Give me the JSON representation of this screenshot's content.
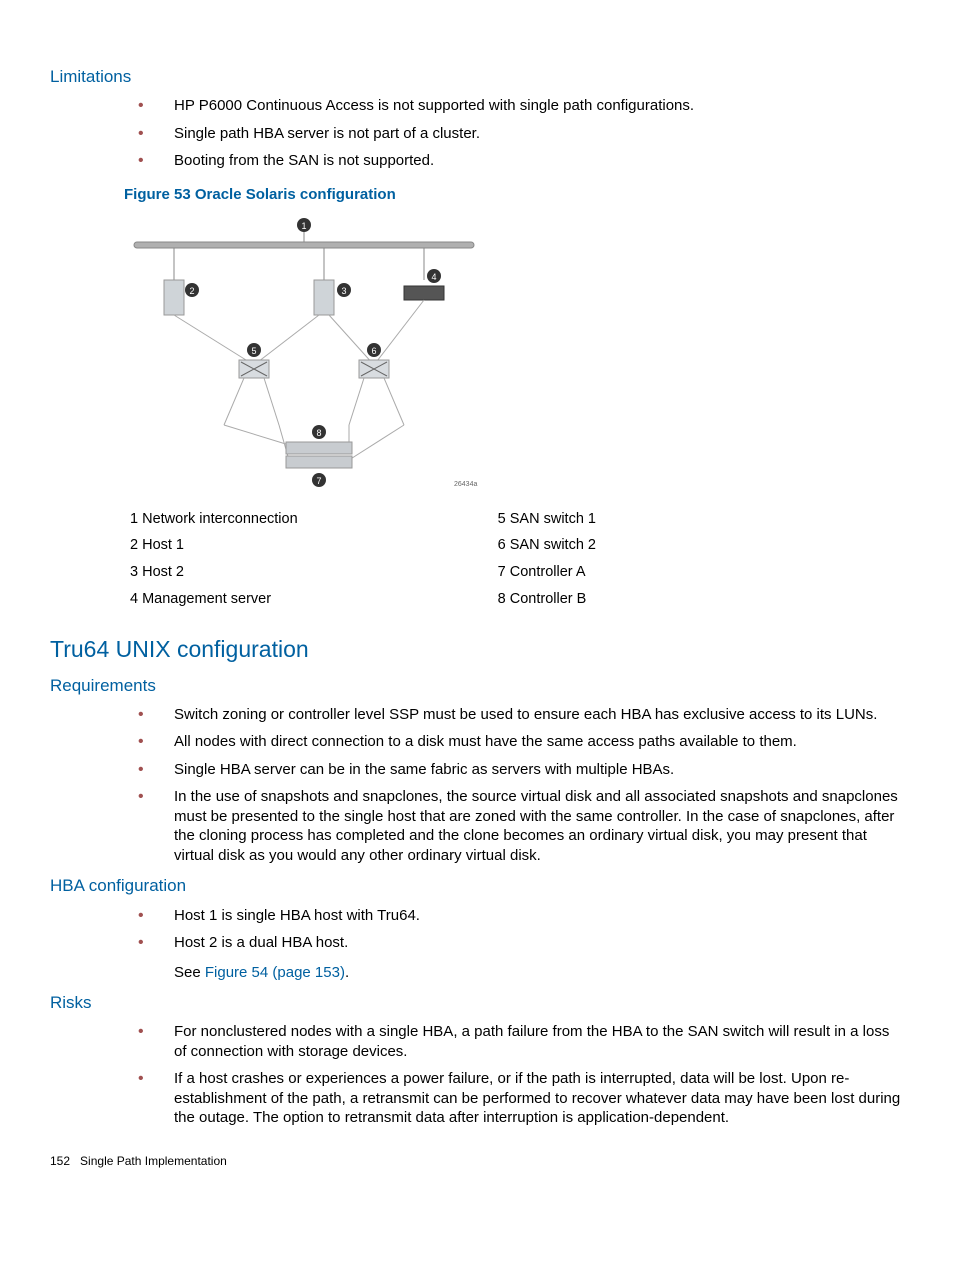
{
  "limitations": {
    "heading": "Limitations",
    "items": [
      "HP P6000 Continuous Access is not supported with single path configurations.",
      "Single path HBA server is not part of a cluster.",
      "Booting from the SAN is not supported."
    ]
  },
  "figure": {
    "caption": "Figure 53 Oracle Solaris configuration",
    "ref": "26434a",
    "legend_left": [
      "1 Network interconnection",
      "2 Host 1",
      "3 Host 2",
      "4 Management server"
    ],
    "legend_right": [
      "5 SAN switch 1",
      "6 SAN switch 2",
      "7 Controller A",
      "8 Controller B"
    ]
  },
  "section": {
    "heading": "Tru64 UNIX configuration"
  },
  "requirements": {
    "heading": "Requirements",
    "items": [
      "Switch zoning or controller level SSP must be used to ensure each HBA has exclusive access to its LUNs.",
      "All nodes with direct connection to a disk must have the same access paths available to them.",
      "Single HBA server can be in the same fabric as servers with multiple HBAs.",
      "In the use of snapshots and snapclones, the source virtual disk and all associated snapshots and snapclones must be presented to the single host that are zoned with the same controller. In the case of snapclones, after the cloning process has completed and the clone becomes an ordinary virtual disk, you may present that virtual disk as you would any other ordinary virtual disk."
    ]
  },
  "hba": {
    "heading": "HBA configuration",
    "items": [
      "Host 1 is single HBA host with Tru64.",
      "Host 2 is a dual HBA host."
    ],
    "see_prefix": "See ",
    "see_link": "Figure 54 (page 153)",
    "see_suffix": "."
  },
  "risks": {
    "heading": "Risks",
    "items": [
      "For nonclustered nodes with a single HBA, a path failure from the HBA to the SAN switch will result in a loss of connection with storage devices.",
      "If a host crashes or experiences a power failure, or if the path is interrupted, data will be lost. Upon re-establishment of the path, a retransmit can be performed to recover whatever data may have been lost during the outage. The option to retransmit data after interruption is application-dependent."
    ]
  },
  "footer": {
    "page": "152",
    "title": "Single Path Implementation"
  }
}
